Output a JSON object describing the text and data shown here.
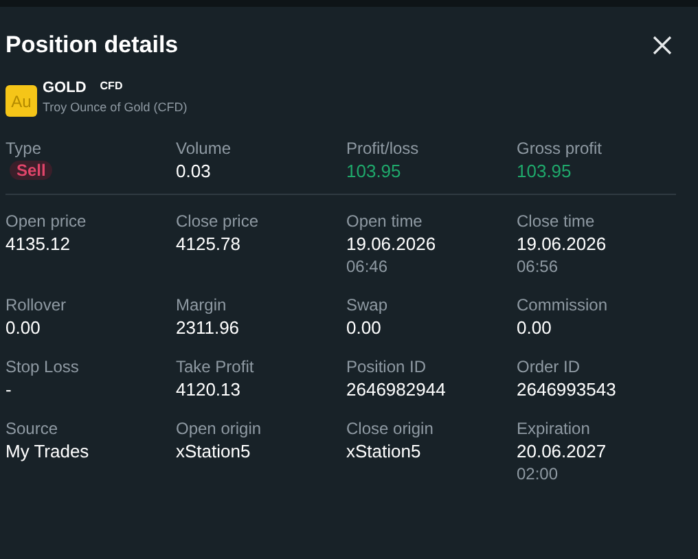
{
  "title": "Position details",
  "instrument": {
    "logo": "Au",
    "symbol": "GOLD",
    "tag": "CFD",
    "description": "Troy Ounce of Gold (CFD)"
  },
  "summary": [
    {
      "label": "Type",
      "value": "Sell",
      "kind": "badge"
    },
    {
      "label": "Volume",
      "value": "0.03",
      "kind": "plain"
    },
    {
      "label": "Profit/loss",
      "value": "103.95",
      "kind": "positive"
    },
    {
      "label": "Gross profit",
      "value": "103.95",
      "kind": "positive"
    }
  ],
  "details": [
    {
      "label": "Open price",
      "value": "4135.12"
    },
    {
      "label": "Close price",
      "value": "4125.78"
    },
    {
      "label": "Open time",
      "value": "19.06.2026",
      "subvalue": "06:46"
    },
    {
      "label": "Close time",
      "value": "19.06.2026",
      "subvalue": "06:56"
    },
    {
      "label": "Rollover",
      "value": "0.00"
    },
    {
      "label": "Margin",
      "value": "2311.96"
    },
    {
      "label": "Swap",
      "value": "0.00"
    },
    {
      "label": "Commission",
      "value": "0.00"
    },
    {
      "label": "Stop Loss",
      "value": "-"
    },
    {
      "label": "Take Profit",
      "value": "4120.13"
    },
    {
      "label": "Position ID",
      "value": "2646982944"
    },
    {
      "label": "Order ID",
      "value": "2646993543"
    },
    {
      "label": "Source",
      "value": "My Trades"
    },
    {
      "label": "Open origin",
      "value": "xStation5"
    },
    {
      "label": "Close origin",
      "value": "xStation5"
    },
    {
      "label": "Expiration",
      "value": "20.06.2027",
      "subvalue": "02:00"
    }
  ]
}
